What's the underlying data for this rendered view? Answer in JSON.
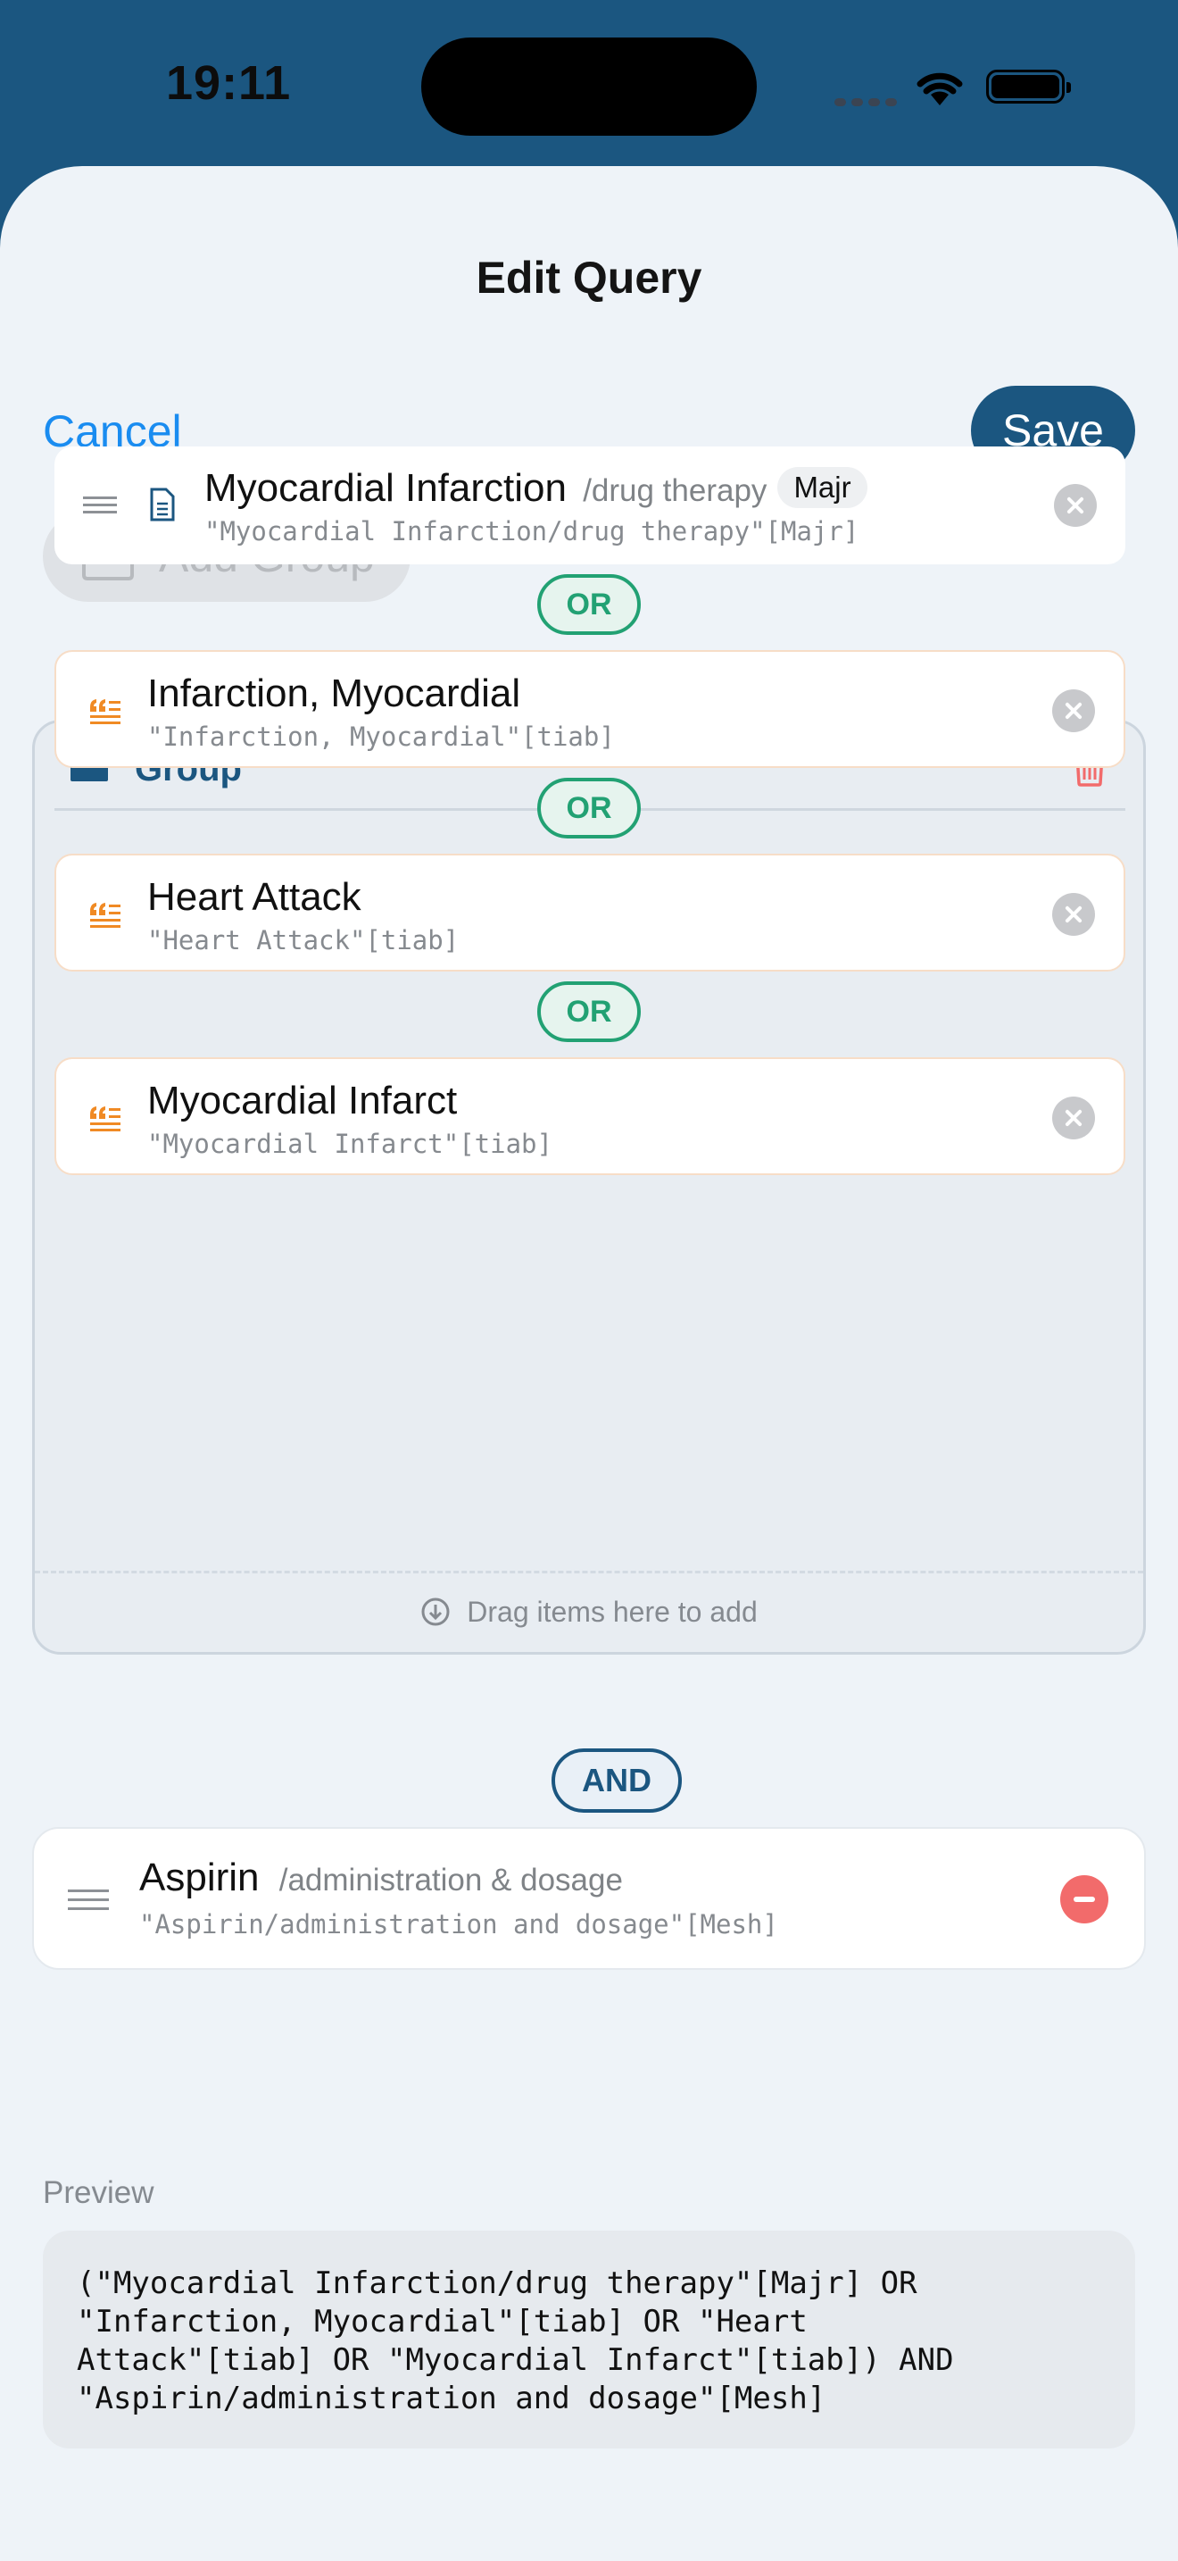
{
  "status_bar": {
    "time": "19:11"
  },
  "nav": {
    "title": "Edit Query",
    "cancel_label": "Cancel",
    "save_label": "Save"
  },
  "toolbar": {
    "add_group_label": "Add Group"
  },
  "group": {
    "label": "Group",
    "items": [
      {
        "term": "Myocardial Infarction",
        "subheading": "/drug therapy",
        "tag": "Majr",
        "query": "\"Myocardial Infarction/drug therapy\"[Majr]",
        "kind": "mesh"
      },
      {
        "term": "Infarction, Myocardial",
        "query": "\"Infarction, Myocardial\"[tiab]",
        "kind": "phrase"
      },
      {
        "term": "Heart Attack",
        "query": "\"Heart Attack\"[tiab]",
        "kind": "phrase"
      },
      {
        "term": "Myocardial Infarct",
        "query": "\"Myocardial Infarct\"[tiab]",
        "kind": "phrase"
      }
    ],
    "operators": [
      "OR",
      "OR",
      "OR"
    ],
    "drop_hint": "Drag items here to add"
  },
  "root_operator": "AND",
  "aspirin_item": {
    "term": "Aspirin",
    "subheading": "/administration & dosage",
    "query": "\"Aspirin/administration and dosage\"[Mesh]"
  },
  "preview": {
    "label": "Preview",
    "text": "(\"Myocardial Infarction/drug therapy\"[Majr] OR\n\"Infarction, Myocardial\"[tiab] OR \"Heart\nAttack\"[tiab] OR \"Myocardial Infarct\"[tiab]) AND\n\"Aspirin/administration and dosage\"[Mesh]"
  },
  "colors": {
    "brand": "#1b5680",
    "link": "#1a8cf0",
    "or_green": "#22a173",
    "phrase_orange": "#f08a24",
    "danger": "#f26b6b"
  }
}
